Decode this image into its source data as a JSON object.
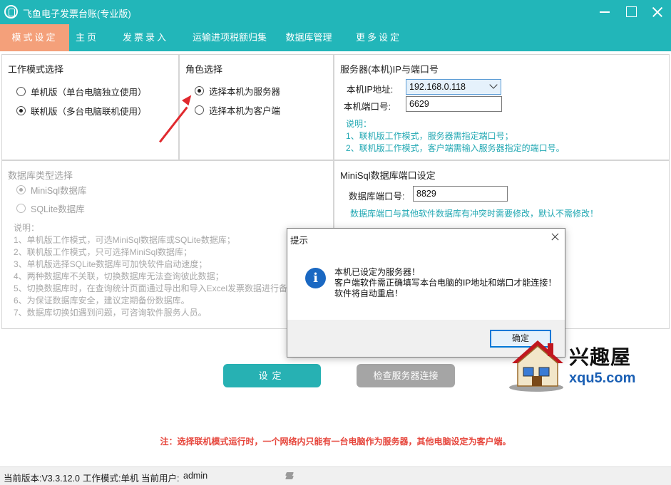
{
  "titlebar": {
    "title": "飞鱼电子发票台账(专业版)"
  },
  "menu": [
    {
      "label": "模式设定",
      "active": true
    },
    {
      "label": "主页"
    },
    {
      "label": "发票录入"
    },
    {
      "label": "运输进项税额归集"
    },
    {
      "label": "数据库管理"
    },
    {
      "label": "更多设定"
    }
  ],
  "mode_panel": {
    "title": "工作模式选择",
    "options": [
      {
        "label": "单机版（单台电脑独立使用）",
        "checked": false
      },
      {
        "label": "联机版（多台电脑联机使用）",
        "checked": true
      }
    ]
  },
  "role_panel": {
    "title": "角色选择",
    "options": [
      {
        "label": "选择本机为服务器",
        "checked": true
      },
      {
        "label": "选择本机为客户端",
        "checked": false
      }
    ]
  },
  "server_panel": {
    "title": "服务器(本机)IP与端口号",
    "ip_label": "本机IP地址:",
    "ip_value": "192.168.0.118",
    "port_label": "本机端口号:",
    "port_value": "6629",
    "notes": [
      "说明：",
      "1、联机版工作模式，服务器需指定端口号；",
      "2、联机版工作模式，客户端需输入服务器指定的端口号。"
    ]
  },
  "db_type_panel": {
    "title": "数据库类型选择",
    "options": [
      {
        "label": "MiniSql数据库",
        "checked": true
      },
      {
        "label": "SQLite数据库",
        "checked": false
      }
    ],
    "notes": [
      "说明：",
      "1、单机版工作模式，可选MiniSql数据库或SQLite数据库；",
      "2、联机版工作模式，只可选择MiniSql数据库；",
      "3、单机版选择SQLite数据库可加快软件启动速度；",
      "4、两种数据库不关联，切换数据库无法查询彼此数据；",
      "5、切换数据库时，在查询统计页面通过导出和导入Excel发票数据进行备",
      "6、为保证数据库安全，建议定期备份数据库。",
      "7、数据库切换如遇到问题，可咨询软件服务人员。"
    ]
  },
  "minisql_panel": {
    "title": "MiniSql数据库端口设定",
    "port_label": "数据库端口号:",
    "port_value": "8829",
    "note": "数据库端口与其他软件数据库有冲突时需要修改，默认不需修改！"
  },
  "buttons": {
    "set": "设定",
    "check": "检查服务器连接"
  },
  "warning": "注：选择联机模式运行时，一个网络内只能有一台电脑作为服务器，其他电脑设定为客户端。",
  "statusbar": {
    "version": "当前版本:V3.3.12.0",
    "mode": "工作模式:单机",
    "user_label": "当前用户:",
    "user": "admin"
  },
  "dialog": {
    "title": "提示",
    "lines": [
      "本机已设定为服务器！",
      "客户端软件需正确填写本台电脑的IP地址和端口才能连接！",
      "软件将自动重启！"
    ],
    "ok": "确定"
  },
  "watermark": {
    "cn": "兴趣屋",
    "en": "xqu5.com"
  },
  "colors": {
    "accent": "#22b6b9",
    "active_tab": "#f4a07a",
    "note": "#22a8b3",
    "warning": "#e6463c",
    "arrow": "#e0292e"
  }
}
